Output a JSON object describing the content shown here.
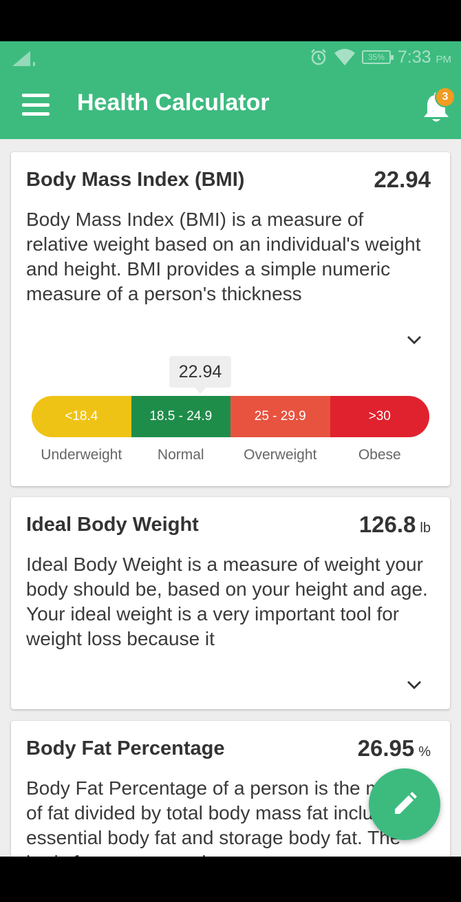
{
  "status_bar": {
    "battery": "35%",
    "time": "7:33",
    "ampm": "PM"
  },
  "app_bar": {
    "title": "Health Calculator",
    "notification_count": "3"
  },
  "bmi_card": {
    "title": "Body Mass Index (BMI)",
    "value": "22.94",
    "description": "Body Mass Index (BMI) is a measure of relative weight based on an individual's weight and height. BMI provides a simple numeric measure of a person's thickness",
    "indicator_value": "22.94",
    "segments": [
      {
        "range": "<18.4",
        "label": "Underweight",
        "color": "#efc315"
      },
      {
        "range": "18.5 - 24.9",
        "label": "Normal",
        "color": "#1f8d4a"
      },
      {
        "range": "25 - 29.9",
        "label": "Overweight",
        "color": "#e8533f"
      },
      {
        "range": ">30",
        "label": "Obese",
        "color": "#e0222e"
      }
    ]
  },
  "ibw_card": {
    "title": "Ideal Body Weight",
    "value": "126.8",
    "unit": "lb",
    "description": "Ideal Body Weight is a measure of weight your body should be, based on your height and age. Your ideal weight is a very important tool for weight loss because it"
  },
  "bfp_card": {
    "title": "Body Fat Percentage",
    "value": "26.95",
    "unit": "%",
    "description": "Body Fat Percentage of a person is the mass of fat divided by total body mass fat includes essential body fat and storage body fat. The body fat percentage is"
  },
  "colors": {
    "primary": "#3dbb7f",
    "badge": "#f39c1f"
  },
  "icons": [
    "menu-icon",
    "bell-icon",
    "chevron-down-icon",
    "edit-pencil-icon",
    "signal-icon",
    "alarm-icon",
    "wifi-icon",
    "battery-icon"
  ]
}
